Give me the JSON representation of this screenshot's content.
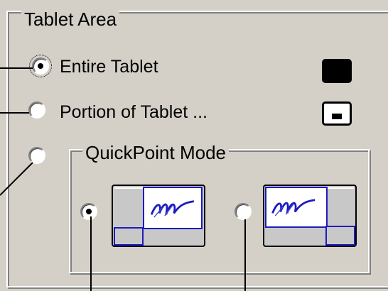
{
  "group": {
    "title": "Tablet Area"
  },
  "options": {
    "entire": {
      "label": "Entire Tablet",
      "selected": true
    },
    "portion": {
      "label": "Portion of Tablet ...",
      "selected": false
    },
    "quickpoint": {
      "selected": false
    }
  },
  "quickpoint": {
    "title": "QuickPoint Mode",
    "left_option": {
      "icon": "tablet-quickpoint-left-icon",
      "selected": true
    },
    "right_option": {
      "icon": "tablet-quickpoint-right-icon",
      "selected": false
    }
  },
  "colors": {
    "panel": "#d4d0c8",
    "accent_blue": "#1c1cc0",
    "leader_line": "#000000"
  }
}
